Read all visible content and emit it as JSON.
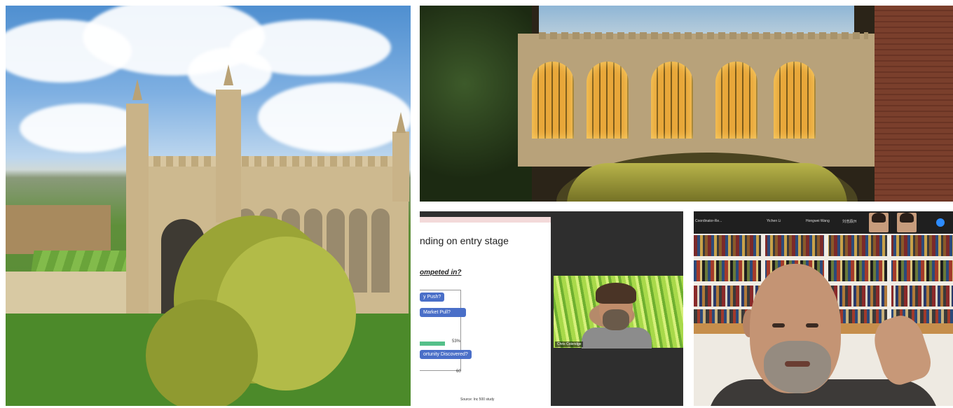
{
  "slide": {
    "title": "nding on entry stage",
    "question": "ompeted in?",
    "pills": [
      "y Push?",
      "Market Pull?",
      "ortunity Discovered?"
    ],
    "bar_percent": "53%",
    "axis_tick": "60",
    "source": "Source: Inc 500 study"
  },
  "speaker_cam": {
    "name": "Chris Coleridge"
  },
  "participant_strip": {
    "labels": [
      "Coordinator-Re...",
      "Yichen Li",
      "Hongwei Wang",
      "刘浩源(H"
    ]
  },
  "colors": {
    "zoom_bg": "#2e2e2e",
    "slide_pill": "#4a6fc8",
    "bar_green": "#55c08a",
    "zoom_blue": "#2d8cff"
  }
}
